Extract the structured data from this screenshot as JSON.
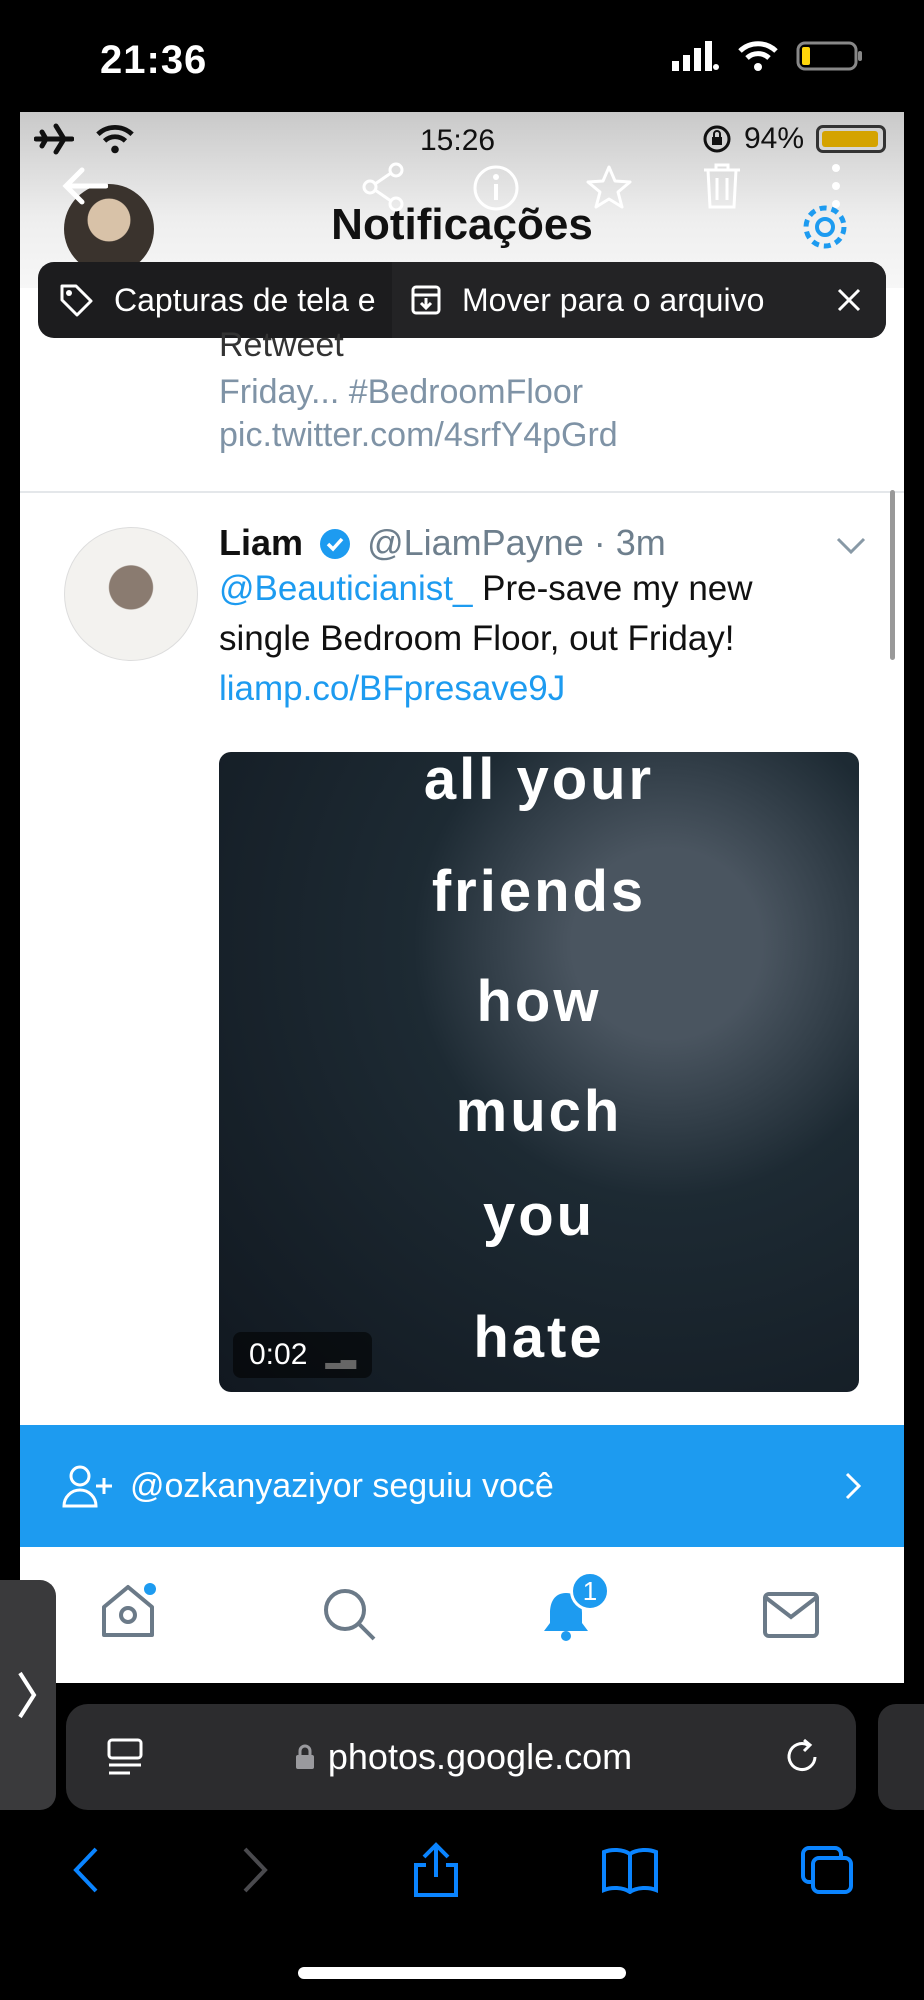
{
  "outer_status": {
    "time": "21:36"
  },
  "inner_status": {
    "time": "15:26",
    "battery": "94%"
  },
  "header": {
    "title": "Notificações"
  },
  "toast": {
    "tag_text": "Capturas de tela e",
    "archive_text": "Mover para o arquivo"
  },
  "prev_tweet": {
    "line1": "Retweet",
    "line2": "Friday... #BedroomFloor",
    "line3": "pic.twitter.com/4srfY4pGrd"
  },
  "tweet": {
    "name": "Liam",
    "handle": "@LiamPayne · 3m",
    "mention": "@Beauticianist_",
    "text_1": " Pre-save my new",
    "text_2": "single Bedroom Floor, out Friday!",
    "link": "liamp.co/BFpresave9J",
    "media_words": [
      "all your",
      "friends",
      "how",
      "much",
      "you",
      "hate"
    ],
    "video_time": "0:02"
  },
  "follow_notice": {
    "text": "@ozkanyaziyor seguiu você"
  },
  "tabbar": {
    "notifications_badge": "1"
  },
  "browser": {
    "url": "photos.google.com"
  },
  "colors": {
    "twitter_blue": "#1d9bf0",
    "ios_blue": "#0a84ff"
  }
}
